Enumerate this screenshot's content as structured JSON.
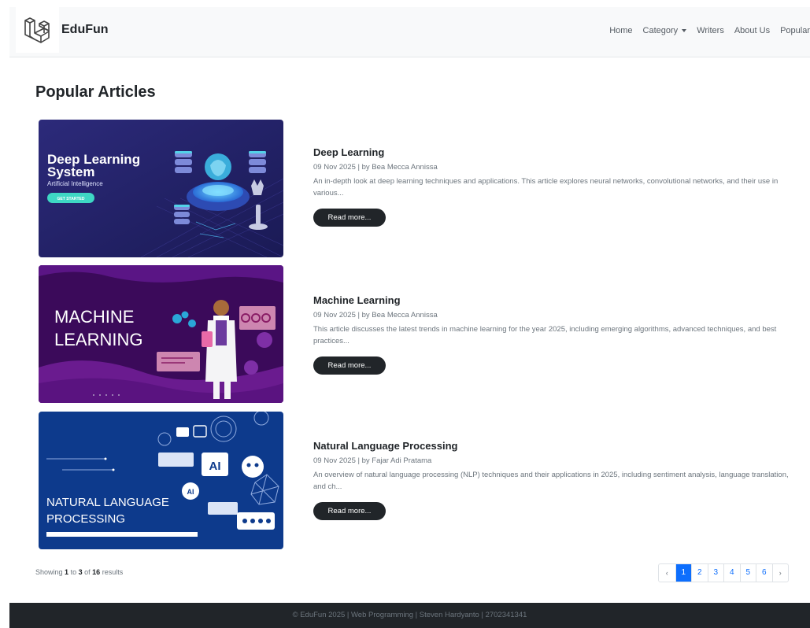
{
  "brand": {
    "name": "EduFun"
  },
  "nav": {
    "home": "Home",
    "category": "Category",
    "writers": "Writers",
    "about": "About Us",
    "popular": "Popular"
  },
  "page": {
    "title": "Popular Articles"
  },
  "articles": [
    {
      "title": "Deep Learning",
      "meta": "09 Nov 2025 | by Bea Mecca Annissa",
      "excerpt": "An in-depth look at deep learning techniques and applications. This article explores neural networks, convolutional networks, and their use in various...",
      "button": "Read more...",
      "image": {
        "line1": "Deep Learning",
        "line2": "System",
        "line3": "Artificial Intelligence",
        "cta": "GET STARTED"
      }
    },
    {
      "title": "Machine Learning",
      "meta": "09 Nov 2025 | by Bea Mecca Annissa",
      "excerpt": "This article discusses the latest trends in machine learning for the year 2025, including emerging algorithms, advanced techniques, and best practices...",
      "button": "Read more...",
      "image": {
        "line1": "MACHINE",
        "line2": "LEARNING"
      }
    },
    {
      "title": "Natural Language Processing",
      "meta": "09 Nov 2025 | by Fajar Adi Pratama",
      "excerpt": "An overview of natural language processing (NLP) techniques and their applications in 2025, including sentiment analysis, language translation, and ch...",
      "button": "Read more...",
      "image": {
        "line1": "NATURAL LANGUAGE",
        "line2": "PROCESSING",
        "ai1": "AI",
        "ai2": "AI"
      }
    }
  ],
  "results": {
    "prefix": "Showing",
    "from": "1",
    "to_word": "to",
    "to": "3",
    "of_word": "of",
    "total": "16",
    "suffix": "results"
  },
  "pagination": {
    "prev": "‹",
    "pages": [
      "1",
      "2",
      "3",
      "4",
      "5",
      "6"
    ],
    "next": "›",
    "active": "1"
  },
  "footer": {
    "text": "© EduFun 2025 | Web Programming | Steven Hardyanto | 2702341341"
  },
  "colors": {
    "primary": "#0d6efd",
    "dark": "#212529",
    "muted": "#6c757d",
    "navbar": "#f8f9fa"
  },
  "icons": {
    "logo": "laravel-logo-icon",
    "caret": "caret-down-icon",
    "prev": "chevron-left-icon",
    "next": "chevron-right-icon"
  }
}
